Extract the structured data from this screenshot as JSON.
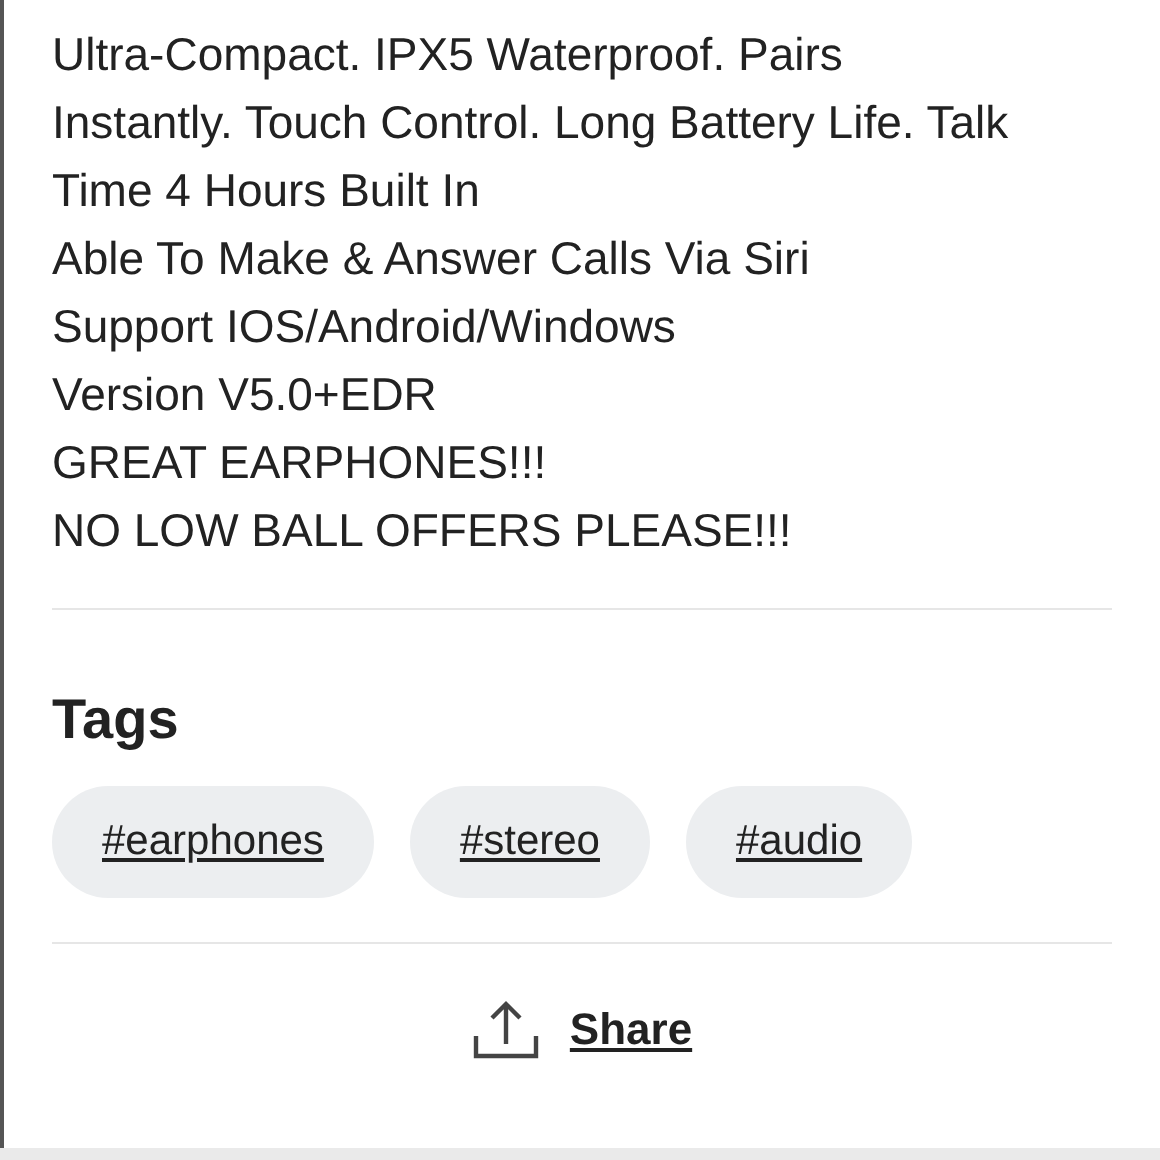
{
  "description_lines": [
    "Ultra-Compact. IPX5 Waterproof. Pairs",
    "Instantly. Touch Control. Long Battery Life. Talk",
    "Time 4 Hours Built In",
    "Able To Make & Answer Calls Via Siri",
    "Support IOS/Android/Windows",
    "Version V5.0+EDR",
    "GREAT EARPHONES!!!",
    "NO LOW BALL OFFERS PLEASE!!!"
  ],
  "tags": {
    "heading": "Tags",
    "items": [
      "#earphones",
      "#stereo",
      "#audio"
    ]
  },
  "share": {
    "label": "Share"
  }
}
